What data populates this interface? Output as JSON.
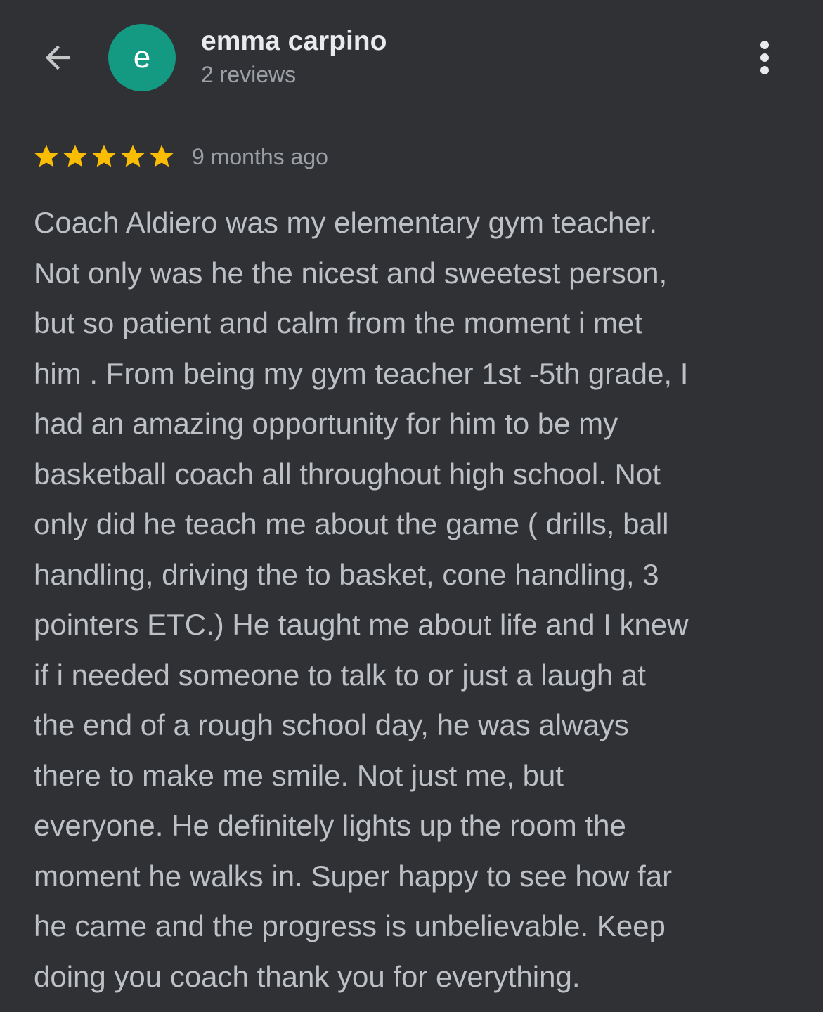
{
  "header": {
    "avatar_letter": "e",
    "avatar_color": "#149a82",
    "author_name": "emma carpino",
    "review_count": "2 reviews",
    "back_icon": "arrow-back-icon",
    "more_icon": "more-vert-icon"
  },
  "review": {
    "rating": 5,
    "rating_max": 5,
    "star_color": "#fbbc04",
    "timestamp": "9 months ago",
    "lines": [
      "Coach Aldiero was my elementary gym teacher.",
      "Not only was he the nicest and sweetest person,",
      "but so patient and calm from the moment i met",
      "him . From being my gym teacher 1st -5th grade, I",
      "had an amazing opportunity for him to be my",
      "basketball coach all throughout high school. Not",
      "only did he teach me about the game ( drills, ball",
      "handling, driving the to basket, cone handling, 3",
      "pointers ETC.) He taught me about life and I knew",
      "if i needed someone to talk to or just a laugh at",
      "the end of a rough school day, he was always",
      "there to make me smile. Not just me, but",
      "everyone. He definitely lights up the room the",
      "moment he walks in. Super happy to see how far",
      "he came and the progress is unbelievable. Keep",
      "doing you coach thank you for everything."
    ]
  }
}
